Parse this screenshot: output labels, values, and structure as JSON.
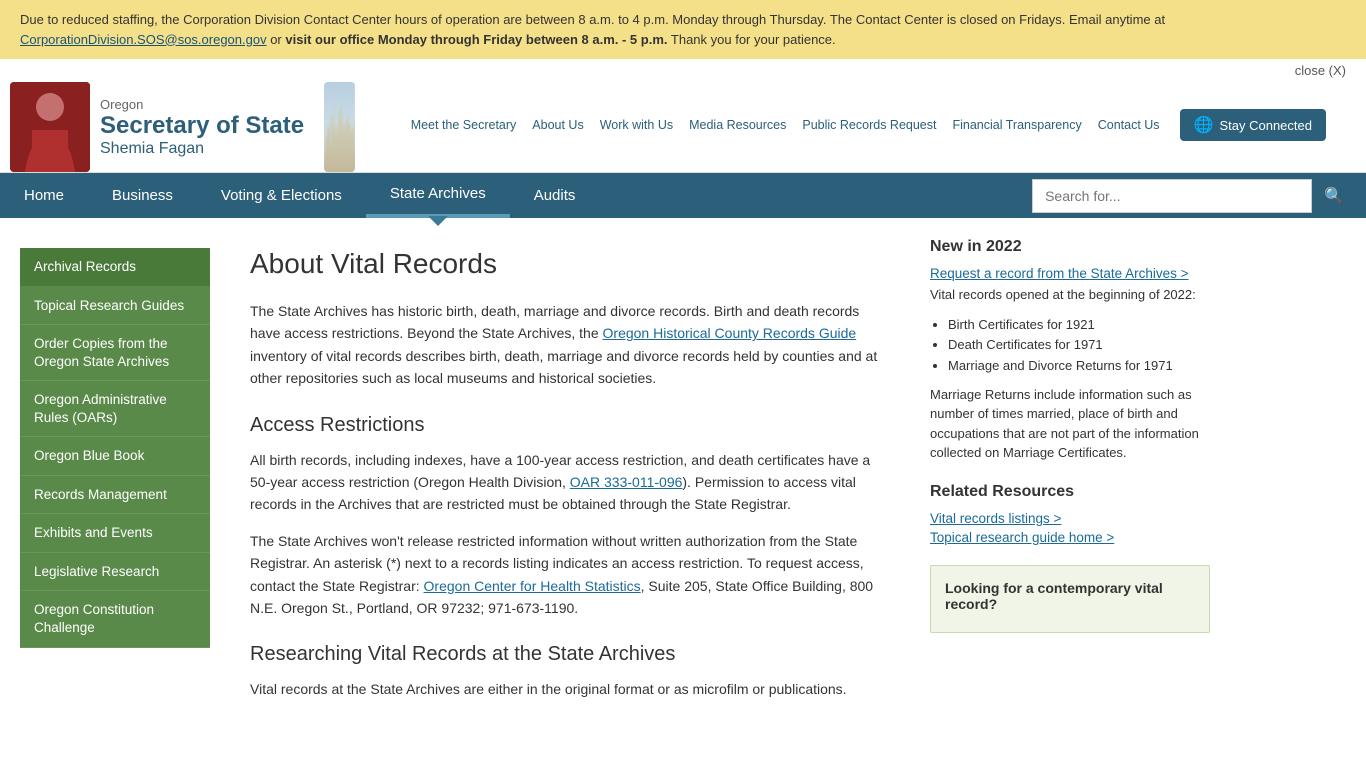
{
  "alert": {
    "text1": "Due to reduced staffing, the Corporation Division Contact Center hours of operation are between 8 a.m. to 4 p.m. Monday through Thursday. The Contact Center is closed on Fridays. Email anytime at ",
    "email": "CorporationDivision.SOS@sos.oregon.gov",
    "text2": " or ",
    "bold_text": "visit our office Monday through Friday between 8 a.m. - 5 p.m.",
    "text3": " Thank you for your patience."
  },
  "close_label": "close (X)",
  "logo": {
    "oregon": "Oregon",
    "sos": "Secretary of State",
    "name": "Shemia Fagan"
  },
  "top_nav": {
    "items": [
      {
        "label": "Meet the Secretary"
      },
      {
        "label": "About Us"
      },
      {
        "label": "Work with Us"
      },
      {
        "label": "Media Resources"
      },
      {
        "label": "Public Records Request"
      },
      {
        "label": "Financial Transparency"
      },
      {
        "label": "Contact Us"
      }
    ],
    "stay_connected": "Stay Connected"
  },
  "main_nav": {
    "items": [
      {
        "label": "Home"
      },
      {
        "label": "Business"
      },
      {
        "label": "Voting & Elections"
      },
      {
        "label": "State Archives",
        "active": true
      },
      {
        "label": "Audits"
      }
    ],
    "search_placeholder": "Search for..."
  },
  "sidebar": {
    "active_item": "Archival Records",
    "items": [
      {
        "label": "Archival Records",
        "active": true
      },
      {
        "label": "Topical Research Guides"
      },
      {
        "label": "Order Copies from the Oregon State Archives"
      },
      {
        "label": "Oregon Administrative Rules (OARs)"
      },
      {
        "label": "Oregon Blue Book"
      },
      {
        "label": "Records Management"
      },
      {
        "label": "Exhibits and Events"
      },
      {
        "label": "Legislative Research"
      },
      {
        "label": "Oregon Constitution Challenge"
      }
    ]
  },
  "main": {
    "title": "About Vital Records",
    "intro": "The State Archives has historic birth, death, marriage and divorce records. Birth and death records have access restrictions. Beyond the State Archives, the ",
    "link1": "Oregon Historical County Records Guide",
    "intro2": " inventory of vital records describes birth, death, marriage and divorce records held by counties and at other repositories such as local museums and historical societies.",
    "section1_title": "Access Restrictions",
    "section1_p1": "All birth records, including indexes, have a 100-year access restriction, and death certificates have a 50-year access restriction (Oregon Health Division, ",
    "link2": "OAR 333-011-096",
    "section1_p1b": "). Permission to access vital records in the Archives that are restricted must be obtained through the State Registrar.",
    "section1_p2_start": "The State Archives won't release restricted information without written authorization from the State Registrar. An asterisk (*) next to a records listing indicates an access restriction. To request access, contact the State Registrar: ",
    "link3": "Oregon Center for Health Statistics",
    "section1_p2_end": ", Suite 205, State Office Building, 800 N.E. Oregon St., Portland, OR 97232; 971-673-1190.",
    "section2_title": "Researching Vital Records at the State Archives",
    "section2_p1": "Vital records at the State Archives are either in the original format or as microfilm or publications."
  },
  "right_sidebar": {
    "new_in_2022": "New in 2022",
    "request_link": "Request a record from the State Archives >",
    "opened_text": "Vital records opened at the beginning of 2022:",
    "opened_items": [
      "Birth Certificates for 1921",
      "Death Certificates for 1971",
      "Marriage and Divorce Returns for 1971"
    ],
    "marriage_text": "Marriage Returns include information such as number of times married, place of birth and occupations that are not part of the information collected on Marriage Certificates.",
    "related_title": "Related Resources",
    "vital_link": "Vital records listings >",
    "topical_link": "Topical research guide home >",
    "contemporary_title": "Looking for a contemporary vital record?"
  }
}
